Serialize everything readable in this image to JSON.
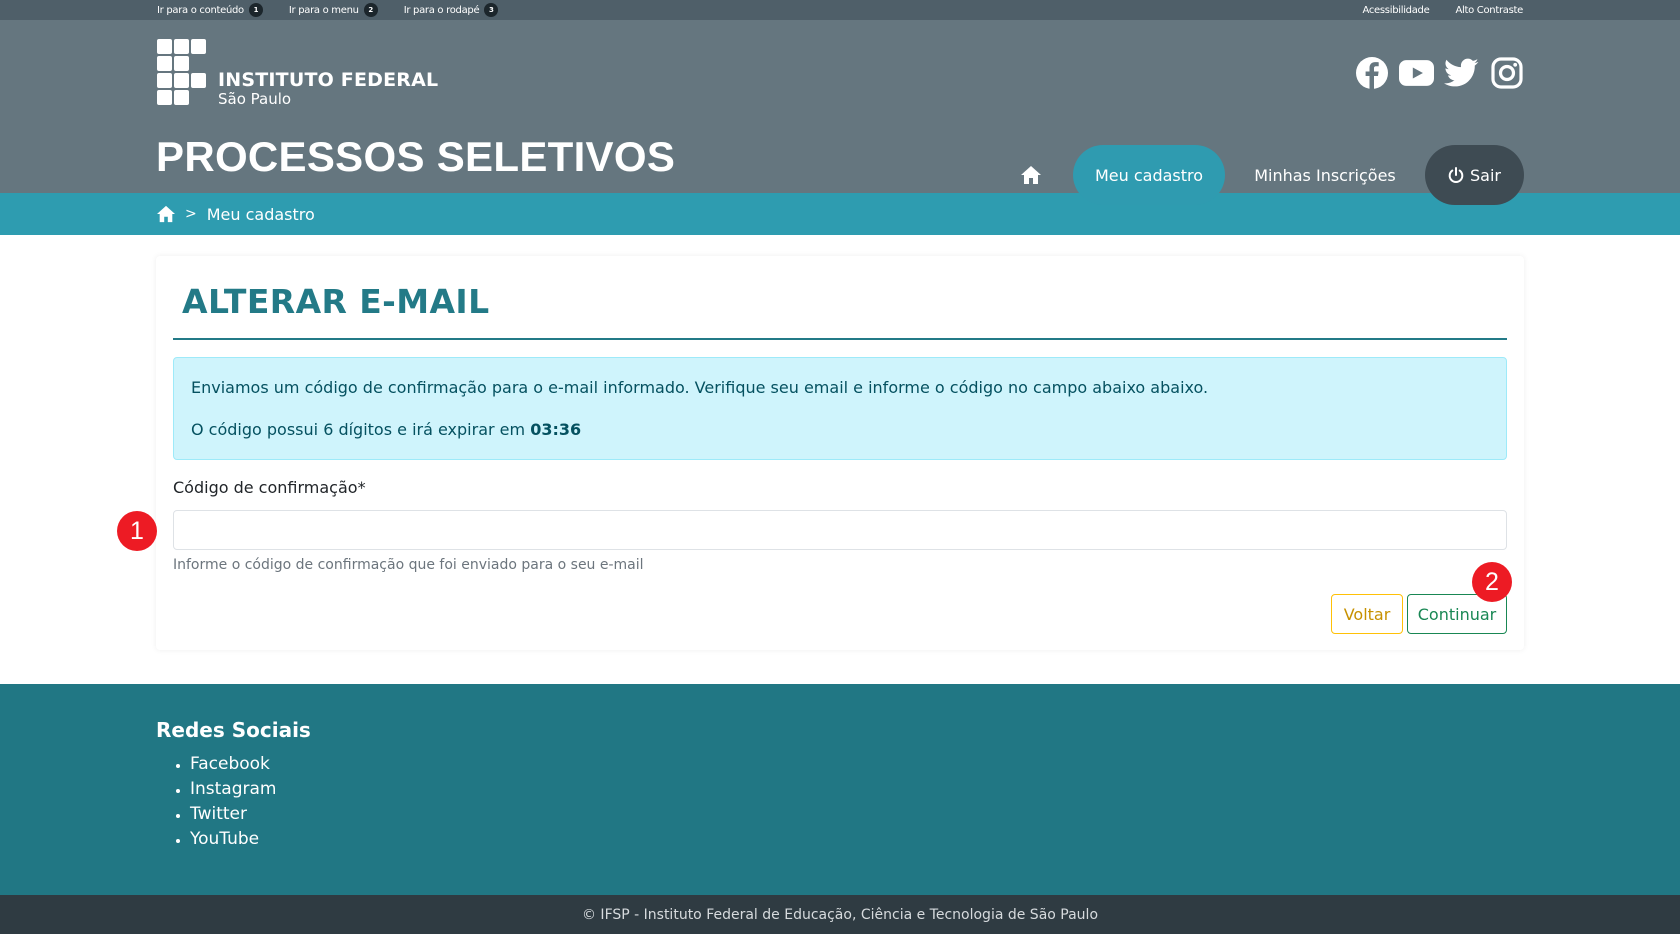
{
  "topbar": {
    "skip_links": [
      {
        "label": "Ir para o conteúdo",
        "num": "1"
      },
      {
        "label": "Ir para o menu",
        "num": "2"
      },
      {
        "label": "Ir para o rodapé",
        "num": "3"
      }
    ],
    "accessibility": "Acessibilidade",
    "high_contrast": "Alto Contraste"
  },
  "header": {
    "logo_title": "INSTITUTO FEDERAL",
    "logo_subtitle": "São Paulo",
    "site_title": "PROCESSOS SELETIVOS",
    "social_icons": [
      "facebook-icon",
      "youtube-icon",
      "twitter-icon",
      "instagram-icon"
    ],
    "nav": {
      "home_icon": "home-icon",
      "meu_cadastro": "Meu cadastro",
      "minhas_inscricoes": "Minhas Inscrições",
      "sair": "Sair"
    }
  },
  "breadcrumb": {
    "separator": ">",
    "current": "Meu cadastro"
  },
  "form": {
    "title": "ALTERAR E-MAIL",
    "alert_line1": "Enviamos um código de confirmação para o e-mail informado. Verifique seu email e informe o código no campo abaixo abaixo.",
    "alert_line2_prefix": "O código possui 6 dígitos e irá expirar em ",
    "alert_timer": "03:36",
    "field_label": "Código de confirmação*",
    "field_value": "",
    "field_help": "Informe o código de confirmação que foi enviado para o seu e-mail",
    "btn_back": "Voltar",
    "btn_continue": "Continuar"
  },
  "markers": {
    "first": "1",
    "second": "2"
  },
  "footer": {
    "title": "Redes Sociais",
    "links": [
      "Facebook",
      "Instagram",
      "Twitter",
      "YouTube"
    ],
    "copyright": "© IFSP - Instituto Federal de Educação, Ciência e Tecnologia de São Paulo"
  },
  "colors": {
    "header_bg": "#65767f",
    "topbar_bg": "#4f5f69",
    "accent": "#2e9cb0",
    "title_teal": "#237a87",
    "footer_bg": "#217784",
    "marker_red": "#ed1b24"
  }
}
